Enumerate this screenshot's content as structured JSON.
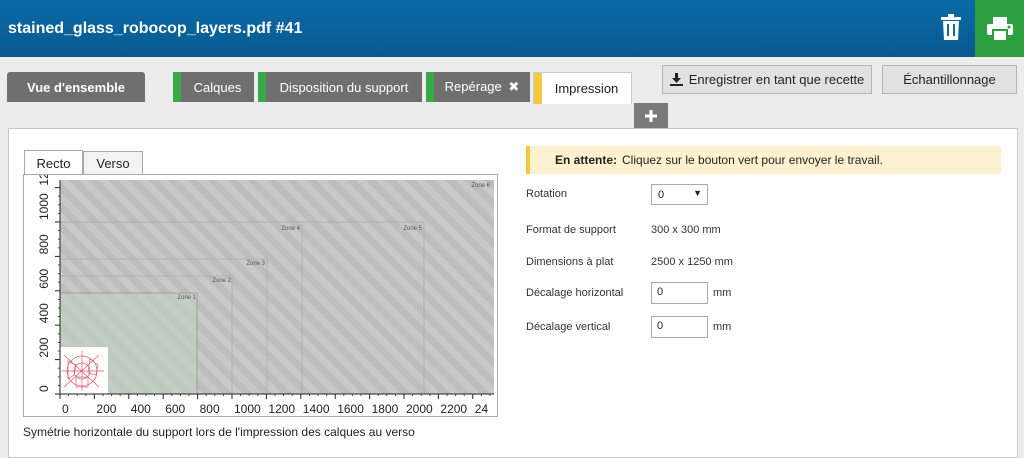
{
  "header": {
    "title": "stained_glass_robocop_layers.pdf #41"
  },
  "tabs": {
    "overview": "Vue d'ensemble",
    "layers": "Calques",
    "media_layout": "Disposition du support",
    "registration": "Repérage",
    "registration_close": "✖",
    "print": "Impression"
  },
  "actions": {
    "save_recipe": "Enregistrer en tant que recette",
    "sampling": "Échantillonnage",
    "add": "+"
  },
  "view_tabs": {
    "front": "Recto",
    "back": "Verso"
  },
  "preview": {
    "zones": [
      "Zone 1",
      "Zone 2",
      "Zone 3",
      "Zone 4",
      "Zone 5",
      "Zone 6"
    ],
    "x_ticks": [
      "0",
      "200",
      "400",
      "600",
      "800",
      "1000",
      "1200",
      "1400",
      "1600",
      "1800",
      "2000",
      "2200",
      "24"
    ],
    "y_ticks": [
      "0",
      "200",
      "400",
      "600",
      "800",
      "1000",
      "1200"
    ],
    "caption": "Symétrie horizontale du support lors de l'impression des calques au verso"
  },
  "status": {
    "label": "En attente:",
    "message": "Cliquez sur le bouton vert pour envoyer le travail."
  },
  "settings": {
    "rotation_label": "Rotation",
    "rotation_value": "0",
    "media_format_label": "Format de support",
    "media_format_value": "300 x 300 mm",
    "flat_dims_label": "Dimensions à plat",
    "flat_dims_value": "2500 x 1250 mm",
    "h_offset_label": "Décalage horizontal",
    "h_offset_value": "0",
    "v_offset_label": "Décalage vertical",
    "v_offset_value": "0",
    "unit": "mm"
  },
  "colors": {
    "header": "#0b6aa8",
    "print_green": "#2e9f41",
    "status_yellow": "#f5c842"
  }
}
